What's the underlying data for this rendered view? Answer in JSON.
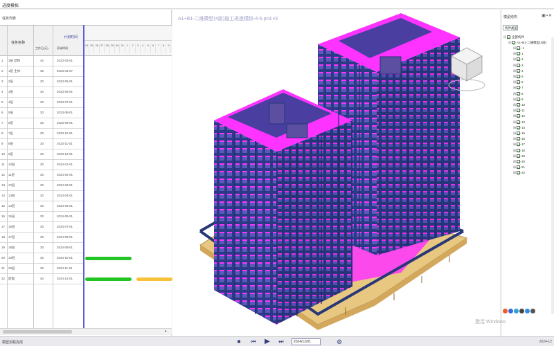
{
  "window": {
    "title": "进度模拟"
  },
  "left_panel": {
    "title": "任务列表",
    "headers": {
      "task_name": "任务名称",
      "plan_time": "计划时间",
      "duration": "工作日(天)",
      "start_date": "开始时间"
    },
    "rows": [
      {
        "no": "1",
        "name": "3层 结构",
        "dur": "42",
        "date": "2023-03-01"
      },
      {
        "no": "2",
        "name": "1层 主体",
        "dur": "35",
        "date": "2023-03-27"
      },
      {
        "no": "3",
        "name": "2层",
        "dur": "30",
        "date": "2023-05-01"
      },
      {
        "no": "4",
        "name": "3层",
        "dur": "30",
        "date": "2023-06-01"
      },
      {
        "no": "5",
        "name": "4层",
        "dur": "30",
        "date": "2023-07-01"
      },
      {
        "no": "6",
        "name": "5层",
        "dur": "30",
        "date": "2023-08-01"
      },
      {
        "no": "7",
        "name": "6层",
        "dur": "30",
        "date": "2023-09-01"
      },
      {
        "no": "8",
        "name": "7层",
        "dur": "30",
        "date": "2023-10-01"
      },
      {
        "no": "9",
        "name": "8层",
        "dur": "30",
        "date": "2023-11-01"
      },
      {
        "no": "10",
        "name": "9层",
        "dur": "30",
        "date": "2023-12-01"
      },
      {
        "no": "11",
        "name": "10层",
        "dur": "30",
        "date": "2024-01-01"
      },
      {
        "no": "12",
        "name": "11层",
        "dur": "30",
        "date": "2024-02-01"
      },
      {
        "no": "13",
        "name": "12层",
        "dur": "30",
        "date": "2024-03-01"
      },
      {
        "no": "14",
        "name": "13层",
        "dur": "30",
        "date": "2024-04-01"
      },
      {
        "no": "15",
        "name": "14层",
        "dur": "30",
        "date": "2024-05-01"
      },
      {
        "no": "16",
        "name": "15层",
        "dur": "30",
        "date": "2024-06-01"
      },
      {
        "no": "17",
        "name": "16层",
        "dur": "30",
        "date": "2024-07-01"
      },
      {
        "no": "18",
        "name": "17层",
        "dur": "30",
        "date": "2024-08-01"
      },
      {
        "no": "19",
        "name": "18层",
        "dur": "30",
        "date": "2024-09-01"
      },
      {
        "no": "20",
        "name": "19层",
        "dur": "30",
        "date": "2024-10-01"
      },
      {
        "no": "21",
        "name": "20层",
        "dur": "30",
        "date": "2024-11-01"
      },
      {
        "no": "22",
        "name": "屋面",
        "dur": "40",
        "date": "2024-12-01"
      }
    ],
    "gantt_days": [
      "24",
      "25",
      "26",
      "27",
      "28",
      "29",
      "30",
      "31",
      "1",
      "2",
      "3",
      "4",
      "5",
      "6",
      "7",
      "8",
      "9"
    ],
    "gantt_bars": [
      {
        "row": 19,
        "start": 0,
        "span": 9,
        "color": "#22c524"
      },
      {
        "row": 21,
        "start": 0,
        "span": 9,
        "color": "#22c524"
      },
      {
        "row": 21,
        "start": 10,
        "span": 7,
        "color": "#f7c23a"
      }
    ]
  },
  "viewport": {
    "title": "A1+B1-二维模型(4层)施工进度模拟-4-5.pcd.v3",
    "colors": {
      "floor": "#5c4ea0",
      "slab": "#ff33ff",
      "base": "#e8c880",
      "grid": "#273778"
    }
  },
  "right_panel": {
    "title": "模型结构",
    "combo": "构件类型",
    "tree_root": "全部构件",
    "tree_sub": "A1+B1-二维模型(4层)",
    "tree_items": [
      "-1",
      "1",
      "2",
      "3",
      "4",
      "5",
      "6",
      "7",
      "8",
      "9",
      "10",
      "11",
      "12",
      "13",
      "14",
      "15",
      "16",
      "17",
      "18",
      "19",
      "20",
      "21",
      "22"
    ]
  },
  "bottom_bar": {
    "status": "模型加载完成",
    "date_value": "2024/12/01",
    "right_date": "2024-12"
  },
  "watermark": "激活 Windows"
}
